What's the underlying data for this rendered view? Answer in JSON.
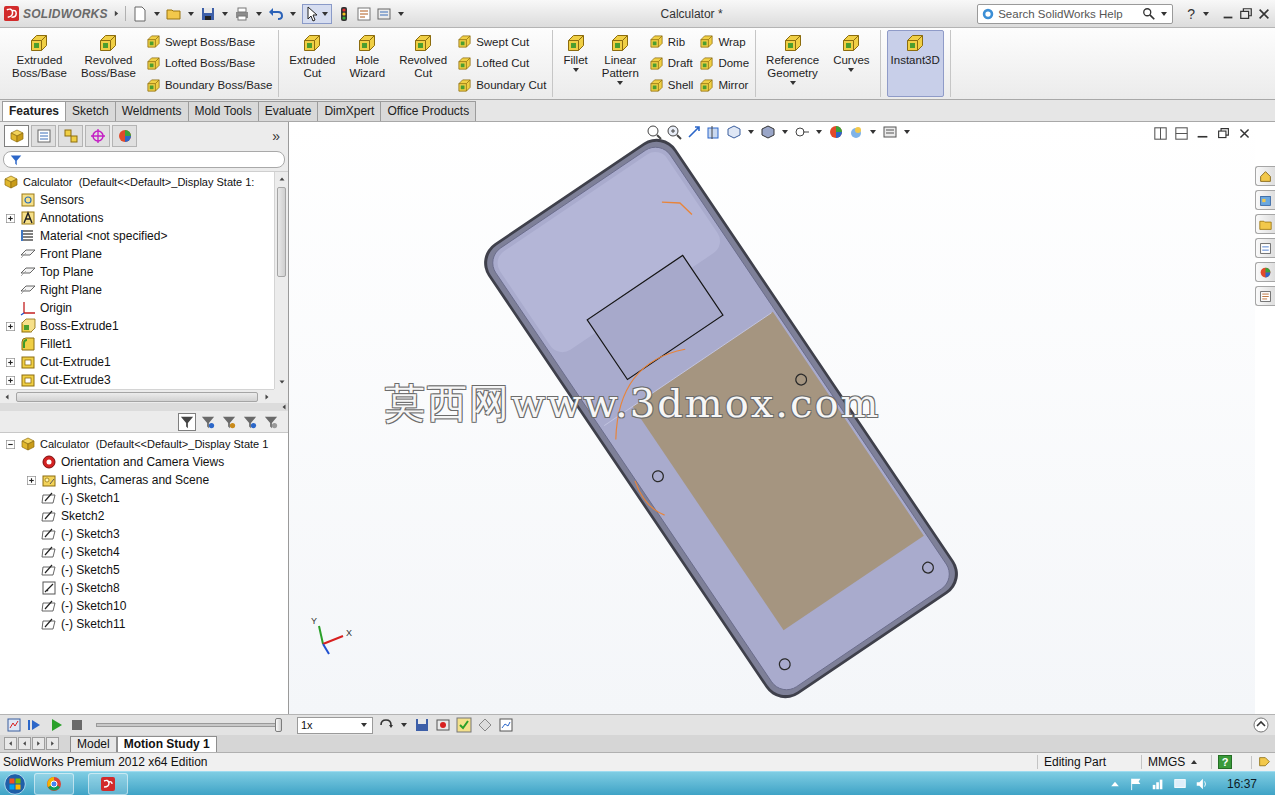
{
  "app": {
    "logo": "SOLIDWORKS",
    "title": "Calculator *",
    "search": {
      "placeholder": "Search SolidWorks Help"
    },
    "help": "?"
  },
  "ribbon": {
    "groups": [
      {
        "items": [
          {
            "kind": "large",
            "label": "Extruded Boss/Base",
            "selected": false,
            "dropdown": false
          },
          {
            "kind": "large",
            "label": "Revolved Boss/Base",
            "selected": false,
            "dropdown": false
          },
          {
            "kind": "stack",
            "labels": [
              "Swept Boss/Base",
              "Lofted Boss/Base",
              "Boundary Boss/Base"
            ]
          }
        ]
      },
      {
        "items": [
          {
            "kind": "large",
            "label": "Extruded Cut",
            "selected": false,
            "dropdown": false
          },
          {
            "kind": "large",
            "label": "Hole Wizard",
            "selected": false,
            "dropdown": false
          },
          {
            "kind": "large",
            "label": "Revolved Cut",
            "selected": false,
            "dropdown": false
          },
          {
            "kind": "stack",
            "labels": [
              "Swept Cut",
              "Lofted Cut",
              "Boundary Cut"
            ]
          }
        ]
      },
      {
        "items": [
          {
            "kind": "large",
            "label": "Fillet",
            "selected": false,
            "dropdown": true
          },
          {
            "kind": "large",
            "label": "Linear Pattern",
            "selected": false,
            "dropdown": true
          },
          {
            "kind": "stack",
            "labels": [
              "Rib",
              "Draft",
              "Shell"
            ]
          },
          {
            "kind": "stack",
            "labels": [
              "Wrap",
              "Dome",
              "Mirror"
            ]
          }
        ]
      },
      {
        "items": [
          {
            "kind": "large",
            "label": "Reference Geometry",
            "selected": false,
            "dropdown": true
          },
          {
            "kind": "large",
            "label": "Curves",
            "selected": false,
            "dropdown": true
          }
        ]
      },
      {
        "items": [
          {
            "kind": "large",
            "label": "Instant3D",
            "selected": true,
            "dropdown": false
          }
        ]
      }
    ]
  },
  "tabs": [
    {
      "label": "Features",
      "selected": true
    },
    {
      "label": "Sketch",
      "selected": false
    },
    {
      "label": "Weldments",
      "selected": false
    },
    {
      "label": "Mold Tools",
      "selected": false
    },
    {
      "label": "Evaluate",
      "selected": false
    },
    {
      "label": "DimXpert",
      "selected": false
    },
    {
      "label": "Office Products",
      "selected": false
    }
  ],
  "feature_tree": {
    "panel_tabs": [
      {
        "selected": true
      },
      {
        "selected": false
      },
      {
        "selected": false
      },
      {
        "selected": false
      },
      {
        "selected": false
      }
    ],
    "more": "»",
    "items": [
      {
        "label": "Calculator  (Default<<Default>_Display State 1:",
        "kind": "part",
        "level": 0,
        "expandable": false,
        "expanded": false
      },
      {
        "label": "Sensors",
        "kind": "sensor",
        "level": 1,
        "expandable": false,
        "expanded": false
      },
      {
        "label": "Annotations",
        "kind": "annotation",
        "level": 1,
        "expandable": true,
        "expanded": false
      },
      {
        "label": "Material <not specified>",
        "kind": "material",
        "level": 1,
        "expandable": false,
        "expanded": false
      },
      {
        "label": "Front Plane",
        "kind": "plane",
        "level": 1,
        "expandable": false,
        "expanded": false
      },
      {
        "label": "Top Plane",
        "kind": "plane",
        "level": 1,
        "expandable": false,
        "expanded": false
      },
      {
        "label": "Right Plane",
        "kind": "plane",
        "level": 1,
        "expandable": false,
        "expanded": false
      },
      {
        "label": "Origin",
        "kind": "origin",
        "level": 1,
        "expandable": false,
        "expanded": false
      },
      {
        "label": "Boss-Extrude1",
        "kind": "extrude",
        "level": 1,
        "expandable": true,
        "expanded": false
      },
      {
        "label": "Fillet1",
        "kind": "fillet",
        "level": 1,
        "expandable": false,
        "expanded": false
      },
      {
        "label": "Cut-Extrude1",
        "kind": "cut",
        "level": 1,
        "expandable": true,
        "expanded": false
      },
      {
        "label": "Cut-Extrude3",
        "kind": "cut",
        "level": 1,
        "expandable": true,
        "expanded": false
      }
    ]
  },
  "motion_tree": {
    "filters": [
      {
        "selected": true
      },
      {
        "selected": false
      },
      {
        "selected": false
      },
      {
        "selected": false
      },
      {
        "selected": false
      }
    ],
    "items": [
      {
        "label": "Calculator  (Default<<Default>_Display State 1",
        "kind": "part",
        "level": 0,
        "expandable": true,
        "expanded": true
      },
      {
        "label": "Orientation and Camera Views",
        "kind": "camera",
        "level": 1,
        "expandable": false,
        "expanded": false
      },
      {
        "label": "Lights, Cameras and Scene",
        "kind": "lights",
        "level": 1,
        "expandable": true,
        "expanded": false
      },
      {
        "label": "(-) Sketch1",
        "kind": "sketch",
        "level": 1,
        "expandable": false,
        "expanded": false
      },
      {
        "label": "Sketch2",
        "kind": "sketch",
        "level": 1,
        "expandable": false,
        "expanded": false
      },
      {
        "label": "(-) Sketch3",
        "kind": "sketch",
        "level": 1,
        "expandable": false,
        "expanded": false
      },
      {
        "label": "(-) Sketch4",
        "kind": "sketch",
        "level": 1,
        "expandable": false,
        "expanded": false
      },
      {
        "label": "(-) Sketch5",
        "kind": "sketch",
        "level": 1,
        "expandable": false,
        "expanded": false
      },
      {
        "label": "(-) Sketch8",
        "kind": "sketch3d",
        "level": 1,
        "expandable": false,
        "expanded": false
      },
      {
        "label": "(-) Sketch10",
        "kind": "sketch",
        "level": 1,
        "expandable": false,
        "expanded": false
      },
      {
        "label": "(-) Sketch11",
        "kind": "sketch",
        "level": 1,
        "expandable": false,
        "expanded": false
      }
    ]
  },
  "graphics": {
    "watermark": "莫西网www.3dmox.com",
    "triad": [
      "Y",
      "X"
    ]
  },
  "motion_bar": {
    "level": 1,
    "speed": "1x"
  },
  "bottom_tabs": [
    {
      "label": "Model",
      "selected": false
    },
    {
      "label": "Motion Study 1",
      "selected": true
    }
  ],
  "status_bar": {
    "edition": "SolidWorks Premium 2012 x64 Edition",
    "mode": "Editing Part",
    "units": "MMGS",
    "help": "?"
  },
  "taskbar": {
    "time": "16:37"
  }
}
